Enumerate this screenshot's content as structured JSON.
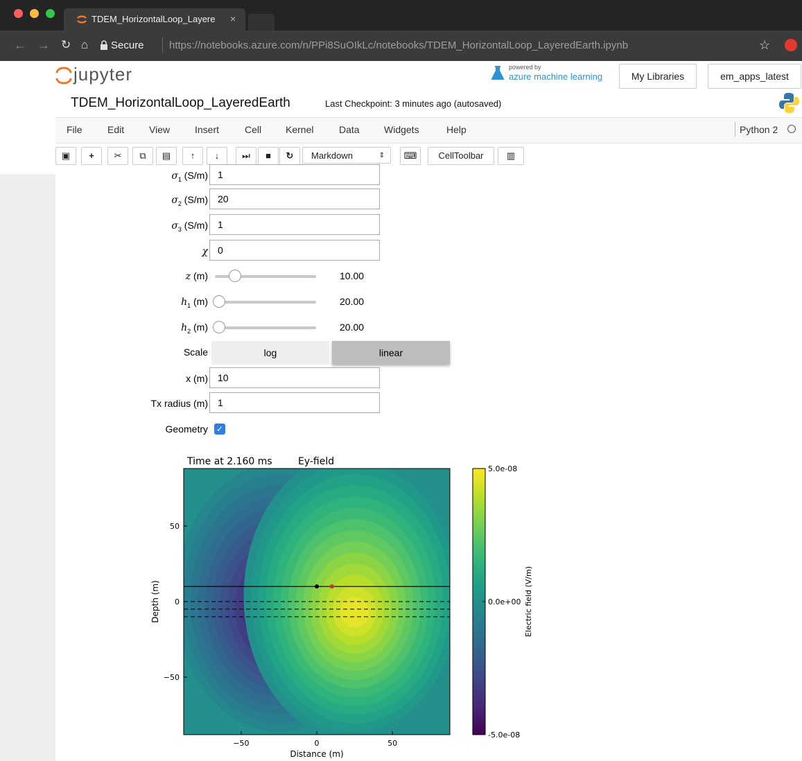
{
  "browser": {
    "tab_title": "TDEM_HorizontalLoop_Layere",
    "secure_label": "Secure",
    "url": "https://notebooks.azure.com/n/PPi8SuOIkLc/notebooks/TDEM_HorizontalLoop_LayeredEarth.ipynb"
  },
  "header": {
    "logo_text": "jupyter",
    "powered_by": "powered by",
    "azure_label": "azure machine learning",
    "my_libraries": "My Libraries",
    "library_name": "em_apps_latest",
    "notebook_title": "TDEM_HorizontalLoop_LayeredEarth",
    "checkpoint": "Last Checkpoint: 3 minutes ago (autosaved)"
  },
  "menu": {
    "items": [
      "File",
      "Edit",
      "View",
      "Insert",
      "Cell",
      "Kernel",
      "Data",
      "Widgets",
      "Help"
    ],
    "kernel": "Python 2"
  },
  "toolbar": {
    "cell_type": "Markdown",
    "celltoolbar": "CellToolbar"
  },
  "widgets": {
    "sigma1": {
      "unit": " (S/m)",
      "value": "1"
    },
    "sigma2": {
      "unit": " (S/m)",
      "value": "20"
    },
    "sigma3": {
      "unit": " (S/m)",
      "value": "1"
    },
    "chi": {
      "value": "0"
    },
    "z": {
      "unit": " (m)",
      "value": "10.00",
      "fraction": 0.2
    },
    "h1": {
      "unit": " (m)",
      "value": "20.00",
      "fraction": 0.04
    },
    "h2": {
      "unit": " (m)",
      "value": "20.00",
      "fraction": 0.04
    },
    "scale": {
      "label": "Scale",
      "options": [
        "log",
        "linear"
      ],
      "selected": "linear"
    },
    "x": {
      "label": "x (m)",
      "value": "10"
    },
    "tx_radius": {
      "label": "Tx radius (m)",
      "value": "1"
    },
    "geometry": {
      "label": "Geometry",
      "checked": true
    }
  },
  "chart_data": {
    "type": "heatmap",
    "title_left": "Time at 2.160 ms",
    "title_right": "Ey-field",
    "xlabel": "Distance (m)",
    "ylabel": "Depth (m)",
    "xlim": [
      -88,
      88
    ],
    "ylim": [
      -88,
      88
    ],
    "xticks": [
      "−50",
      "0",
      "50"
    ],
    "yticks": [
      "50",
      "0",
      "−50"
    ],
    "colorbar_label": "Electric field (V/m)",
    "colorbar_ticks": [
      "5.0e-08",
      "0.0e+00",
      "-5.0e-08"
    ],
    "colormap": "viridis",
    "colorbar_range": [
      -5e-08,
      5e-08
    ],
    "lobes": [
      {
        "x": -25,
        "y": -8,
        "sign": -1
      },
      {
        "x": 25,
        "y": -8,
        "sign": 1
      }
    ],
    "loop_line_depth": 10,
    "layer_boundaries": [
      0,
      -5,
      -10
    ],
    "points": [
      {
        "x": 0,
        "y": 10,
        "color": "#000000"
      },
      {
        "x": 10,
        "y": 10,
        "color": "#c0392b"
      }
    ]
  }
}
